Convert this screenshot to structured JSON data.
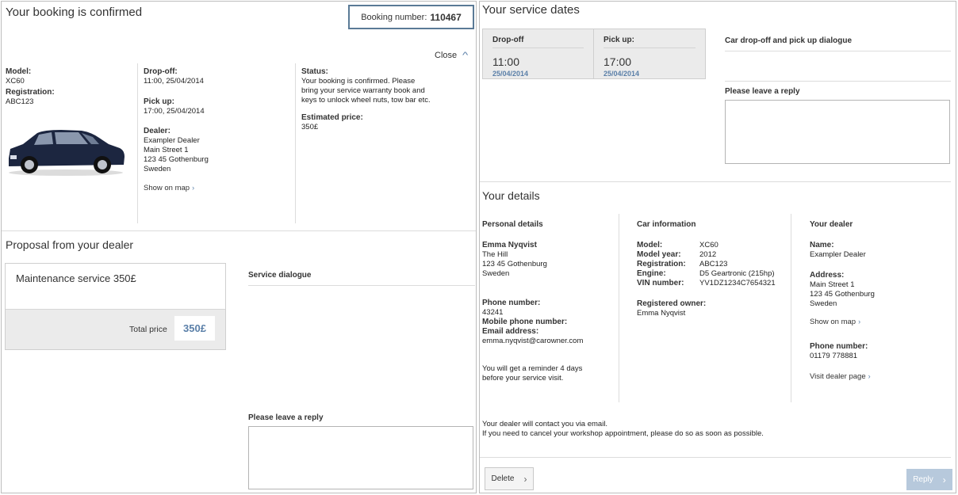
{
  "booking": {
    "title": "Your booking is confirmed",
    "number_label": "Booking number:",
    "number": "110467",
    "close_label": "Close",
    "model_label": "Model:",
    "model": "XC60",
    "registration_label": "Registration:",
    "registration": "ABC123",
    "dropoff_label": "Drop-off:",
    "dropoff": "11:00, 25/04/2014",
    "pickup_label": "Pick up:",
    "pickup": "17:00, 25/04/2014",
    "dealer_label": "Dealer:",
    "dealer_lines": [
      "Exampler Dealer",
      "Main Street 1",
      "123 45 Gothenburg",
      "Sweden"
    ],
    "show_map": "Show on map",
    "status_label": "Status:",
    "status_text": "Your booking is confirmed. Please bring your service warranty book and keys to unlock wheel nuts, tow bar etc.",
    "price_label": "Estimated price:",
    "price": "350£"
  },
  "proposal": {
    "title": "Proposal from your dealer",
    "service": "Maintenance service 350£",
    "total_label": "Total price",
    "total": "350£",
    "dialogue_title": "Service dialogue",
    "reply_label": "Please leave a reply"
  },
  "service_dates": {
    "title": "Your service dates",
    "dropoff_label": "Drop-off",
    "dropoff_time": "11:00",
    "dropoff_date": "25/04/2014",
    "pickup_label": "Pick up:",
    "pickup_time": "17:00",
    "pickup_date": "25/04/2014",
    "dialogue_title": "Car drop-off and pick up dialogue",
    "reply_label": "Please leave a reply"
  },
  "details": {
    "title": "Your details",
    "personal": {
      "heading": "Personal details",
      "name": "Emma Nyqvist",
      "address_lines": [
        "The Hill",
        "123 45 Gothenburg",
        "Sweden"
      ],
      "phone_label": "Phone number:",
      "phone": "43241",
      "mobile_label": "Mobile phone number:",
      "email_label": "Email address:",
      "email": "emma.nyqvist@carowner.com",
      "reminder": "You will get a reminder 4 days before your service visit."
    },
    "car": {
      "heading": "Car information",
      "rows": [
        {
          "k": "Model:",
          "v": "XC60"
        },
        {
          "k": "Model year:",
          "v": "2012"
        },
        {
          "k": "Registration:",
          "v": "ABC123"
        },
        {
          "k": "Engine:",
          "v": "D5 Geartronic (215hp)"
        },
        {
          "k": "VIN number:",
          "v": "YV1DZ1234C7654321"
        }
      ],
      "owner_label": "Registered owner:",
      "owner": "Emma Nyqvist"
    },
    "dealer": {
      "heading": "Your dealer",
      "name_label": "Name:",
      "name": "Exampler Dealer",
      "address_label": "Address:",
      "address_lines": [
        "Main Street 1",
        "123 45 Gothenburg",
        "Sweden"
      ],
      "show_map": "Show on map",
      "phone_label": "Phone number:",
      "phone": "01179 778881",
      "visit": "Visit dealer page"
    },
    "contact_note_1": "Your dealer will contact you via email.",
    "contact_note_2": "If you need to cancel your workshop appointment, please do so as soon as possible."
  },
  "actions": {
    "delete": "Delete",
    "reply": "Reply"
  },
  "colors": {
    "accent": "#5a7fa8",
    "box_border": "#5a7a96",
    "reply_disabled": "#b7c9dc"
  }
}
